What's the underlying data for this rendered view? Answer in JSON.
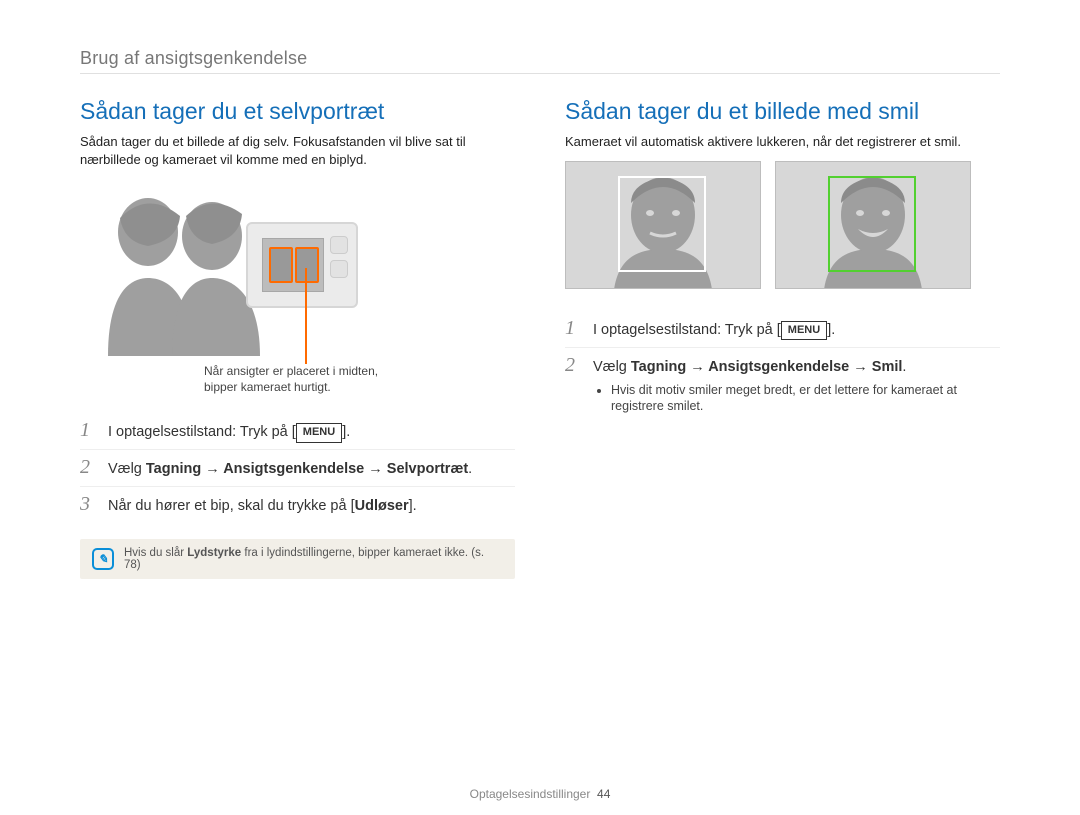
{
  "breadcrumb": "Brug af ansigtsgenkendelse",
  "left": {
    "title": "Sådan tager du et selvportræt",
    "intro": "Sådan tager du et billede af dig selv. Fokusafstanden vil blive sat til nærbillede og kameraet vil komme med en biplyd.",
    "caption_line1": "Når ansigter er placeret i midten,",
    "caption_line2": "bipper kameraet hurtigt.",
    "steps": {
      "s1_pre": "I optagelsestilstand: Tryk på [",
      "s1_menu": "MENU",
      "s1_post": "].",
      "s2_pre": "Vælg ",
      "s2_bold": "Tagning → Ansigtsgenkendelse → Selvportræt",
      "s2_post": ".",
      "s3_pre": "Når du hører et bip, skal du trykke på [",
      "s3_bold": "Udløser",
      "s3_post": "]."
    },
    "note_pre": "Hvis du slår ",
    "note_bold": "Lydstyrke",
    "note_post": " fra i lydindstillingerne, bipper kameraet ikke. (s. 78)"
  },
  "right": {
    "title": "Sådan tager du et billede med smil",
    "intro": "Kameraet vil automatisk aktivere lukkeren, når det registrerer et smil.",
    "steps": {
      "s1_pre": "I optagelsestilstand: Tryk på [",
      "s1_menu": "MENU",
      "s1_post": "].",
      "s2_pre": "Vælg ",
      "s2_bold": "Tagning → Ansigtsgenkendelse → Smil",
      "s2_post": ".",
      "bullet": "Hvis dit motiv smiler meget bredt, er det lettere for kameraet at registrere smilet."
    }
  },
  "footer_label": "Optagelsesindstillinger",
  "footer_page": "44"
}
